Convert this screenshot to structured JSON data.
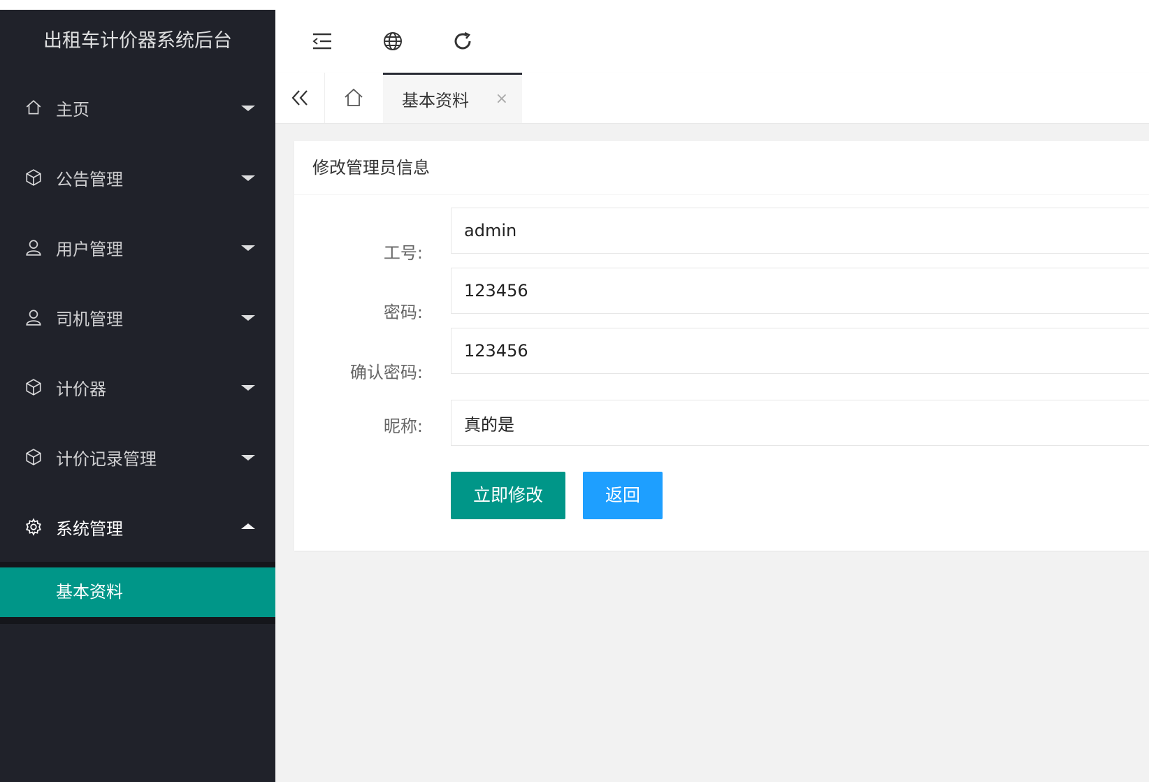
{
  "sidebar": {
    "title": "出租车计价器系统后台",
    "items": [
      {
        "label": "主页",
        "icon": "home-icon"
      },
      {
        "label": "公告管理",
        "icon": "cube-icon"
      },
      {
        "label": "用户管理",
        "icon": "user-icon"
      },
      {
        "label": "司机管理",
        "icon": "user-icon"
      },
      {
        "label": "计价器",
        "icon": "cube-icon"
      },
      {
        "label": "计价记录管理",
        "icon": "cube-icon"
      },
      {
        "label": "系统管理",
        "icon": "gear-icon",
        "expanded": true
      }
    ],
    "sub_items": [
      {
        "label": "基本资料",
        "active": true
      }
    ]
  },
  "header": {
    "icons": [
      "menu-fold-icon",
      "globe-icon",
      "refresh-icon"
    ]
  },
  "tabs": {
    "active_label": "基本资料",
    "close_glyph": "×"
  },
  "form": {
    "title": "修改管理员信息",
    "fields": [
      {
        "label": "工号:",
        "value": "admin"
      },
      {
        "label": "密码:",
        "value": "123456"
      },
      {
        "label": "确认密码:",
        "value": "123456"
      },
      {
        "label": "昵称:",
        "value": "真的是"
      }
    ],
    "submit_label": "立即修改",
    "back_label": "返回"
  },
  "colors": {
    "sidebar_bg": "#20222a",
    "accent": "#009688",
    "secondary": "#1e9fff",
    "content_bg": "#f2f2f2"
  }
}
